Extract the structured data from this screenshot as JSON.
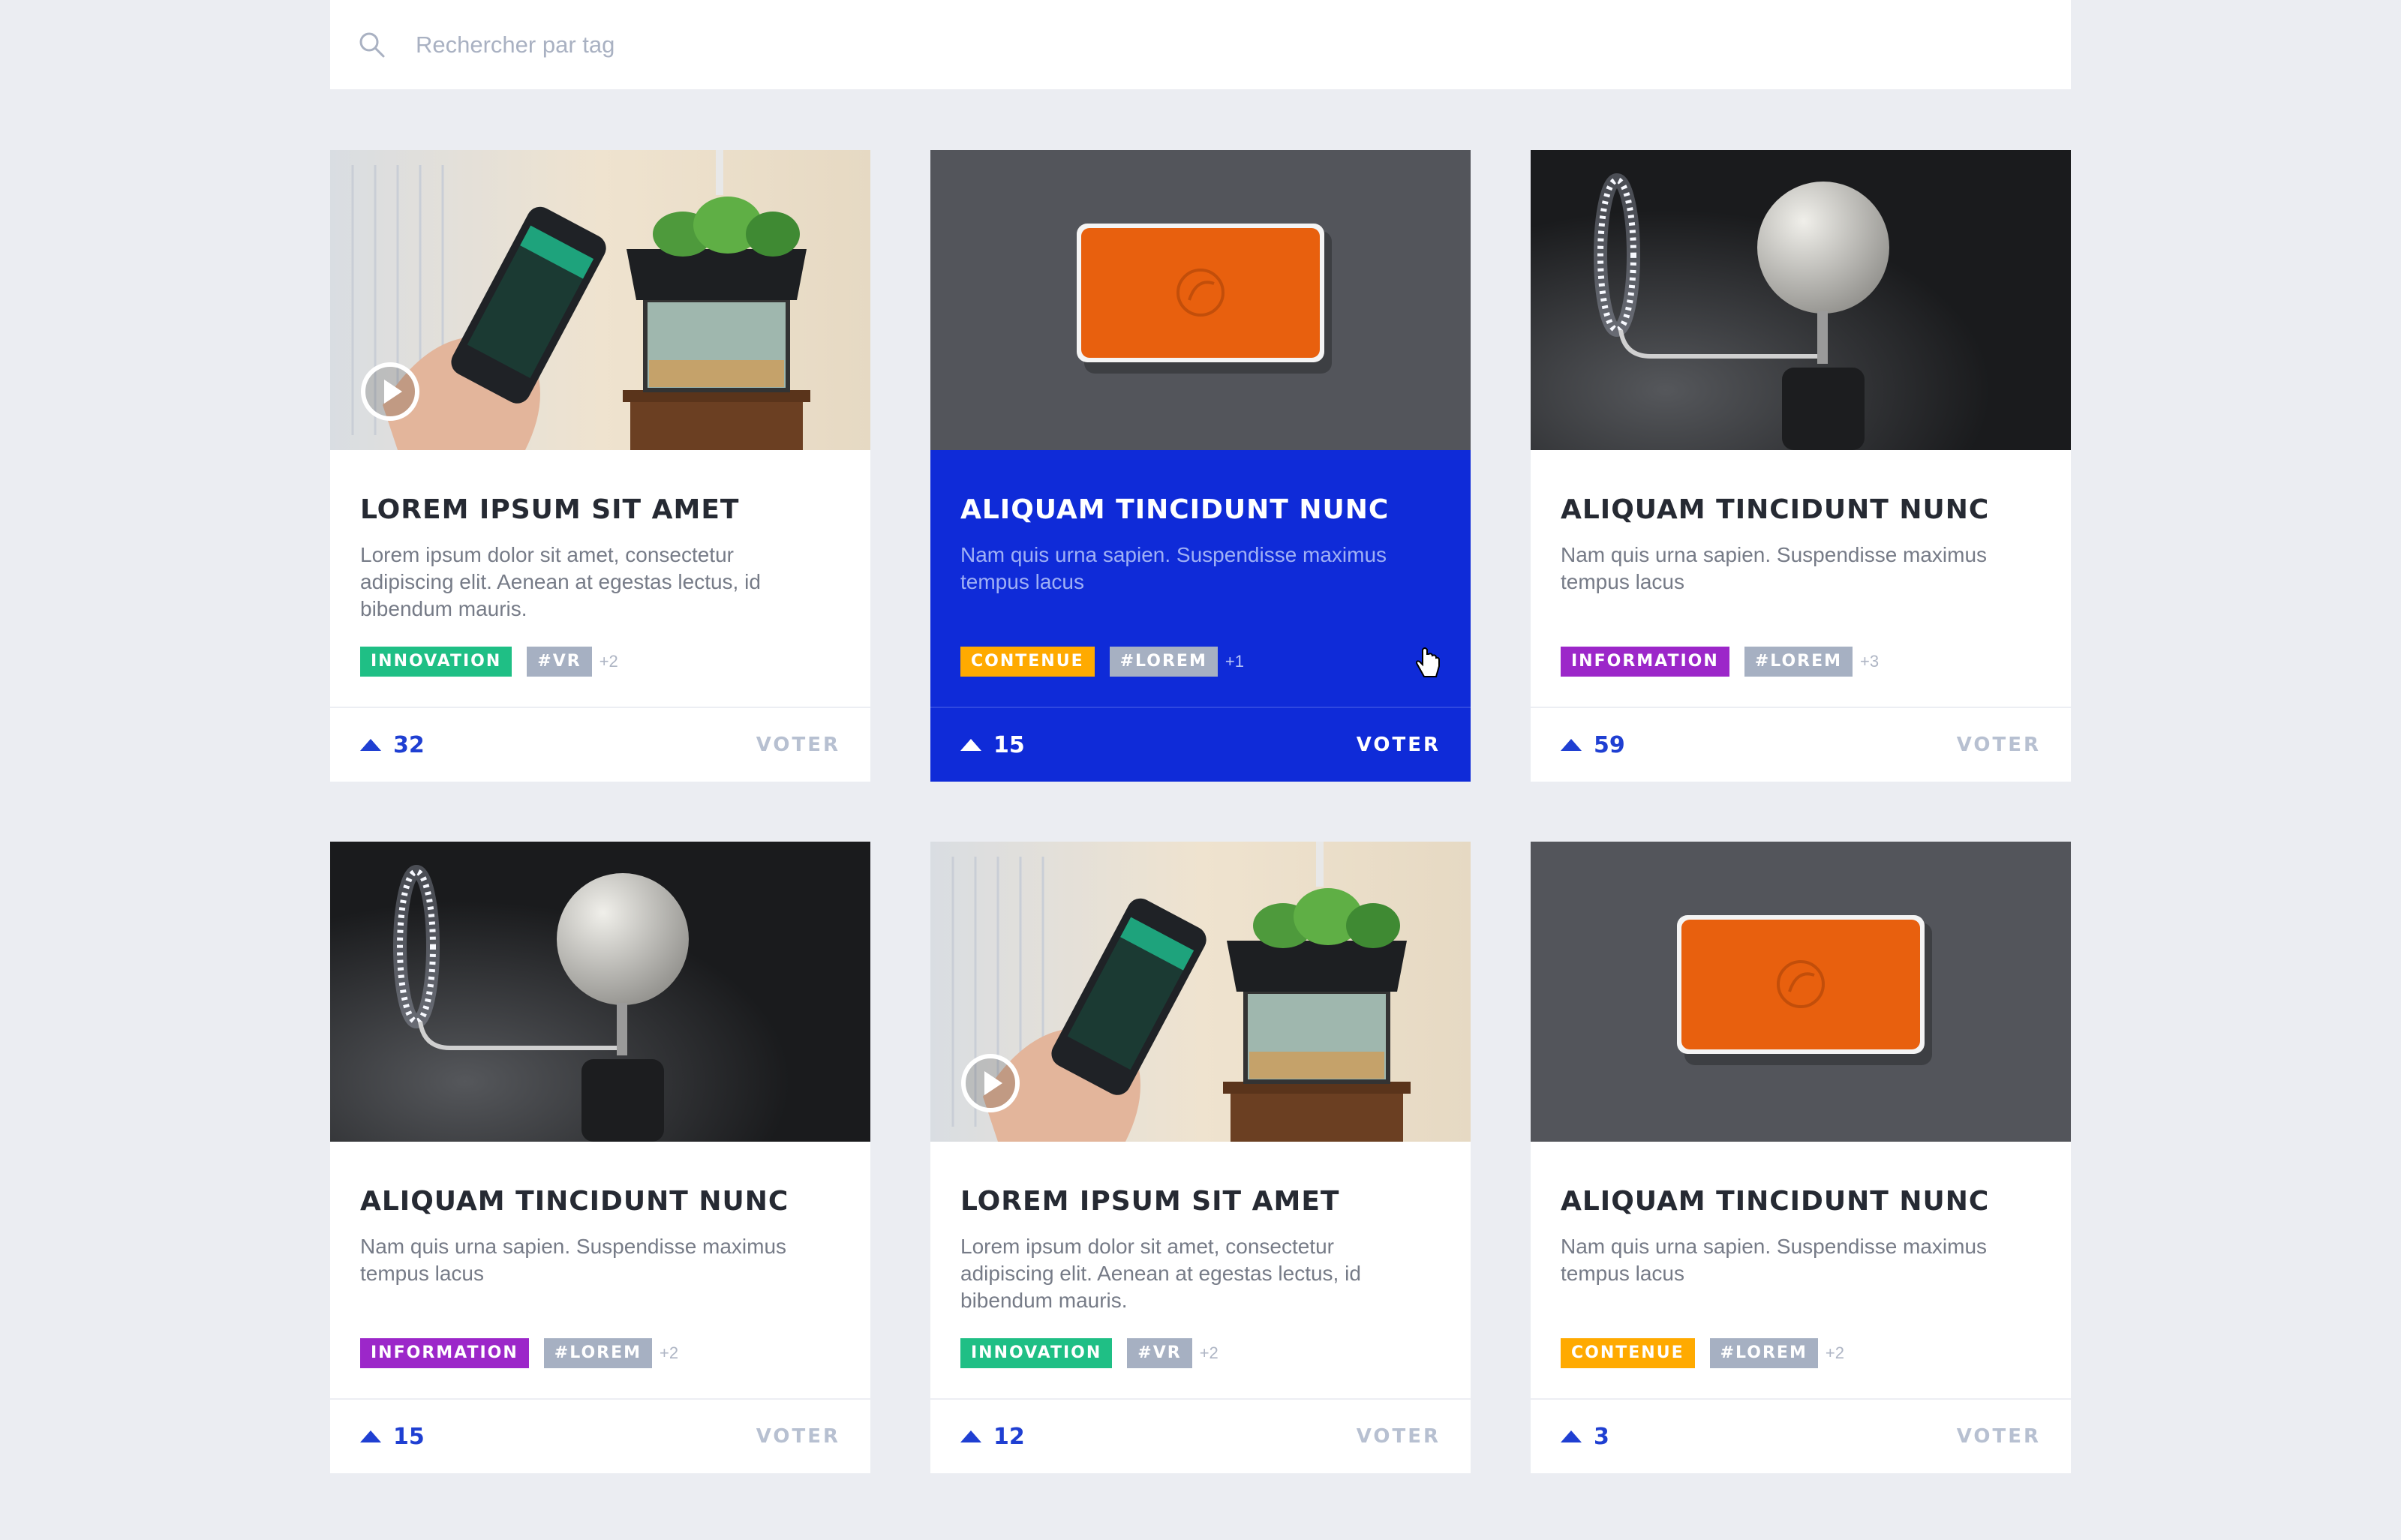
{
  "search": {
    "placeholder": "Rechercher par tag"
  },
  "colors": {
    "accent": "#0f2bd8",
    "innovation": "#1fbf85",
    "contenue": "#ffaa00",
    "information": "#9c27c9",
    "hash_tag": "#a6b0c2"
  },
  "cards": [
    {
      "image": "smartphone-aquaponics-garden",
      "has_video": true,
      "title": "LOREM IPSUM SIT AMET",
      "description": "Lorem ipsum dolor sit amet, consectetur adipiscing elit. Aenean at egestas lectus, id bibendum mauris.",
      "category": "INNOVATION",
      "hashtag": "#VR",
      "extra": "+2",
      "votes": "32",
      "vote_label": "VOTER"
    },
    {
      "image": "orange-wall-device",
      "has_video": false,
      "title": "ALIQUAM TINCIDUNT NUNC",
      "description": "Nam quis urna sapien. Suspendisse maximus tempus lacus",
      "category": "CONTENUE",
      "hashtag": "#LOREM",
      "extra": "+1",
      "votes": "15",
      "vote_label": "VOTER",
      "active": true
    },
    {
      "image": "moon-lamp",
      "has_video": false,
      "title": "ALIQUAM TINCIDUNT NUNC",
      "description": "Nam quis urna sapien. Suspendisse maximus tempus lacus",
      "category": "INFORMATION",
      "hashtag": "#LOREM",
      "extra": "+3",
      "votes": "59",
      "vote_label": "VOTER"
    },
    {
      "image": "moon-lamp",
      "has_video": false,
      "title": "ALIQUAM TINCIDUNT NUNC",
      "description": "Nam quis urna sapien. Suspendisse maximus tempus lacus",
      "category": "INFORMATION",
      "hashtag": "#LOREM",
      "extra": "+2",
      "votes": "15",
      "vote_label": "VOTER"
    },
    {
      "image": "smartphone-aquaponics-garden",
      "has_video": true,
      "title": "LOREM IPSUM SIT AMET",
      "description": "Lorem ipsum dolor sit amet, consectetur adipiscing elit. Aenean at egestas lectus, id bibendum mauris.",
      "category": "INNOVATION",
      "hashtag": "#VR",
      "extra": "+2",
      "votes": "12",
      "vote_label": "VOTER"
    },
    {
      "image": "orange-wall-device",
      "has_video": false,
      "title": "ALIQUAM TINCIDUNT NUNC",
      "description": "Nam quis urna sapien. Suspendisse maximus tempus lacus",
      "category": "CONTENUE",
      "hashtag": "#LOREM",
      "extra": "+2",
      "votes": "3",
      "vote_label": "VOTER"
    }
  ]
}
